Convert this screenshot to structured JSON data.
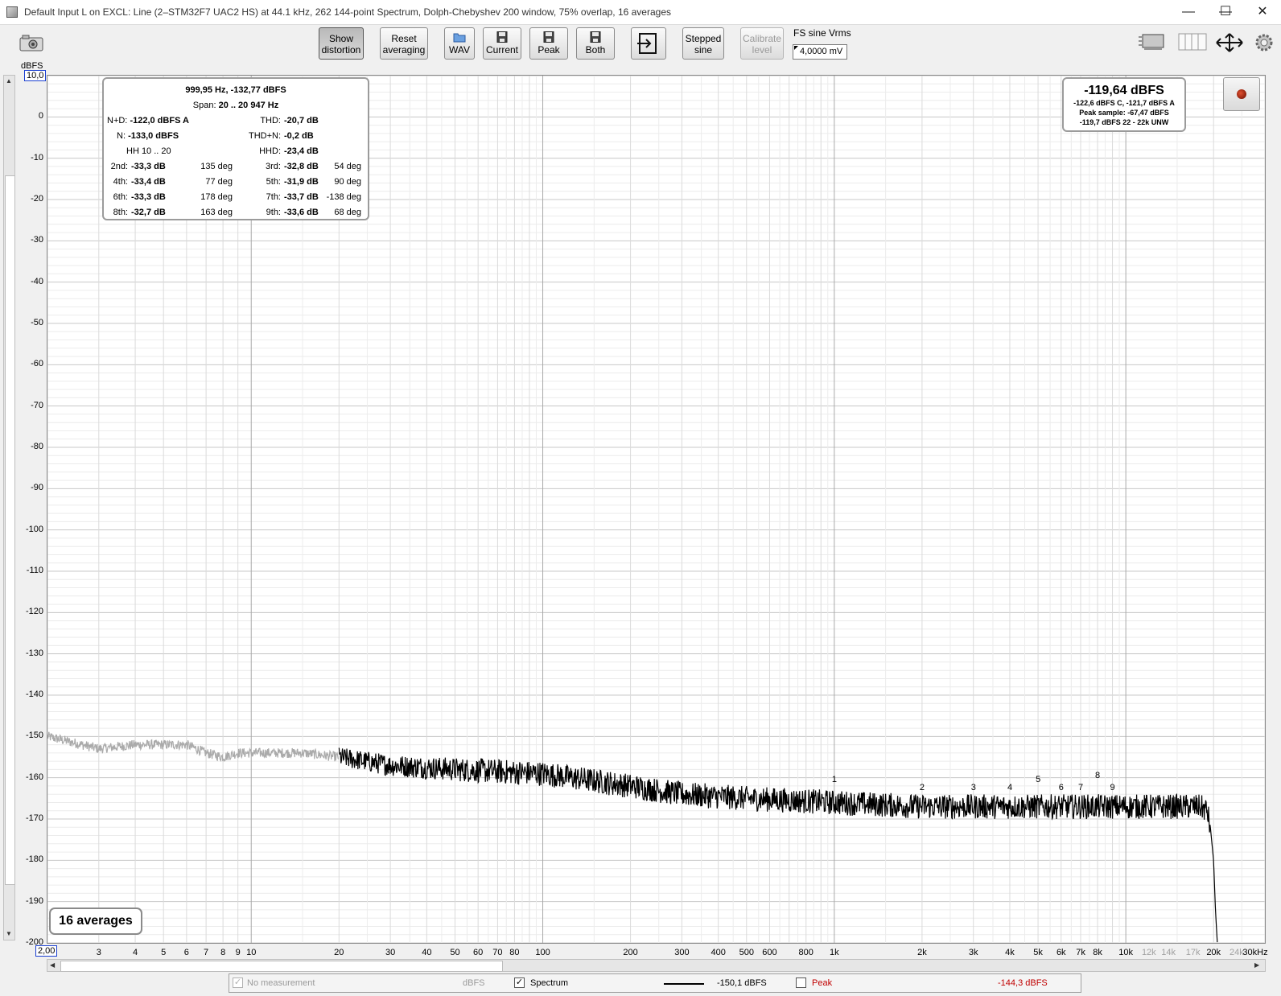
{
  "window": {
    "title": "Default Input L on EXCL: Line (2–STM32F7 UAC2 HS) at 44.1 kHz, 262 144-point Spectrum, Dolph-Chebyshev 200 window, 75% overlap, 16 averages",
    "minimize": "—",
    "maximize": "☐",
    "close": "✕"
  },
  "toolbar": {
    "show_distortion": [
      "Show",
      "distortion"
    ],
    "reset_averaging": [
      "Reset",
      "averaging"
    ],
    "wav": "WAV",
    "current": "Current",
    "peak": "Peak",
    "both": "Both",
    "stepped_sine": [
      "Stepped",
      "sine"
    ],
    "calibrate_level": [
      "Calibrate",
      "level"
    ],
    "fs_label": "FS sine Vrms",
    "fs_value": "4,0000 mV"
  },
  "axes": {
    "y_unit": "dBFS",
    "y_top_box": "10,0",
    "y_ticks": [
      "0",
      "-10",
      "-20",
      "-30",
      "-40",
      "-50",
      "-60",
      "-70",
      "-80",
      "-90",
      "-100",
      "-110",
      "-120",
      "-130",
      "-140",
      "-150",
      "-160",
      "-170",
      "-180",
      "-190",
      "-200"
    ],
    "x_left_box": "2,00",
    "x_ticks": [
      {
        "v": 3,
        "t": "3"
      },
      {
        "v": 4,
        "t": "4"
      },
      {
        "v": 5,
        "t": "5"
      },
      {
        "v": 6,
        "t": "6"
      },
      {
        "v": 7,
        "t": "7"
      },
      {
        "v": 8,
        "t": "8"
      },
      {
        "v": 9,
        "t": "9"
      },
      {
        "v": 10,
        "t": "10"
      },
      {
        "v": 20,
        "t": "20"
      },
      {
        "v": 30,
        "t": "30"
      },
      {
        "v": 40,
        "t": "40"
      },
      {
        "v": 50,
        "t": "50"
      },
      {
        "v": 60,
        "t": "60"
      },
      {
        "v": 70,
        "t": "70"
      },
      {
        "v": 80,
        "t": "80"
      },
      {
        "v": 100,
        "t": "100"
      },
      {
        "v": 200,
        "t": "200"
      },
      {
        "v": 300,
        "t": "300"
      },
      {
        "v": 400,
        "t": "400"
      },
      {
        "v": 500,
        "t": "500"
      },
      {
        "v": 600,
        "t": "600"
      },
      {
        "v": 800,
        "t": "800"
      },
      {
        "v": 1000,
        "t": "1k"
      },
      {
        "v": 2000,
        "t": "2k"
      },
      {
        "v": 3000,
        "t": "3k"
      },
      {
        "v": 4000,
        "t": "4k"
      },
      {
        "v": 5000,
        "t": "5k"
      },
      {
        "v": 6000,
        "t": "6k"
      },
      {
        "v": 7000,
        "t": "7k"
      },
      {
        "v": 8000,
        "t": "8k"
      },
      {
        "v": 10000,
        "t": "10k"
      },
      {
        "v": 12000,
        "t": "12k",
        "light": true
      },
      {
        "v": 14000,
        "t": "14k",
        "light": true
      },
      {
        "v": 17000,
        "t": "17k",
        "light": true
      },
      {
        "v": 20000,
        "t": "20k"
      },
      {
        "v": 24000,
        "t": "24k",
        "light": true
      },
      {
        "v": 30000,
        "t": "30kHz"
      }
    ]
  },
  "distortion": {
    "header": "999,95 Hz, -132,77 dBFS",
    "span_label": "Span:",
    "span_value": "20 .. 20 947 Hz",
    "nd_label": "N+D:",
    "nd_value": "-122,0 dBFS A",
    "thd_label": "THD:",
    "thd_value": "-20,7 dB",
    "n_label": "N:",
    "n_value": "-133,0 dBFS",
    "thdn_label": "THD+N:",
    "thdn_value": "-0,2 dB",
    "hh": "HH 10 .. 20",
    "hhd_label": "HHD:",
    "hhd_value": "-23,4 dB",
    "rows": [
      {
        "l1": "2nd:",
        "v1": "-33,3 dB",
        "p1": "135 deg",
        "l2": "3rd:",
        "v2": "-32,8 dB",
        "p2": "54 deg"
      },
      {
        "l1": "4th:",
        "v1": "-33,4 dB",
        "p1": "77 deg",
        "l2": "5th:",
        "v2": "-31,9 dB",
        "p2": "90 deg"
      },
      {
        "l1": "6th:",
        "v1": "-33,3 dB",
        "p1": "178 deg",
        "l2": "7th:",
        "v2": "-33,7 dB",
        "p2": "-138 deg"
      },
      {
        "l1": "8th:",
        "v1": "-32,7 dB",
        "p1": "163 deg",
        "l2": "9th:",
        "v2": "-33,6 dB",
        "p2": "68 deg"
      }
    ]
  },
  "level": {
    "main": "-119,64 dBFS",
    "line1": "-122,6 dBFS C, -121,7 dBFS A",
    "line2": "Peak sample: -67,47 dBFS",
    "line3": "-119,7 dBFS 22 - 22k UNW"
  },
  "averages_badge": "16 averages",
  "harmonic_markers": [
    {
      "label": "1",
      "f": 1000,
      "db": -162
    },
    {
      "label": "2",
      "f": 2000,
      "db": -164
    },
    {
      "label": "3",
      "f": 3000,
      "db": -164
    },
    {
      "label": "4",
      "f": 4000,
      "db": -164
    },
    {
      "label": "5",
      "f": 5000,
      "db": -162
    },
    {
      "label": "6",
      "f": 6000,
      "db": -164
    },
    {
      "label": "7",
      "f": 7000,
      "db": -164
    },
    {
      "label": "8",
      "f": 8000,
      "db": -161
    },
    {
      "label": "9",
      "f": 9000,
      "db": -164
    }
  ],
  "legend": {
    "no_measurement": "No measurement",
    "unit": "dBFS",
    "spectrum": "Spectrum",
    "spectrum_value": "-150,1 dBFS",
    "peak": "Peak",
    "peak_value": "-144,3 dBFS",
    "peak_color": "#c00000"
  },
  "chart_data": {
    "type": "line",
    "title": "",
    "xlabel": "",
    "ylabel": "dBFS",
    "x_scale": "log",
    "xlim": [
      2,
      30000
    ],
    "ylim": [
      -200,
      10
    ],
    "grid": true,
    "series": [
      {
        "name": "Spectrum",
        "color": "#000000",
        "light_below_hz": 20,
        "light_color": "#aaaaaa",
        "points": [
          [
            2,
            -150
          ],
          [
            3,
            -153
          ],
          [
            4,
            -152
          ],
          [
            5,
            -152
          ],
          [
            6,
            -152
          ],
          [
            7,
            -154
          ],
          [
            8,
            -155
          ],
          [
            9,
            -154
          ],
          [
            10,
            -154
          ],
          [
            15,
            -154
          ],
          [
            20,
            -155
          ],
          [
            30,
            -157
          ],
          [
            50,
            -158
          ],
          [
            100,
            -159
          ],
          [
            200,
            -162
          ],
          [
            300,
            -164
          ],
          [
            500,
            -165
          ],
          [
            1000,
            -166
          ],
          [
            2000,
            -167
          ],
          [
            5000,
            -167
          ],
          [
            10000,
            -167
          ],
          [
            15000,
            -167
          ],
          [
            18000,
            -167
          ],
          [
            19000,
            -168
          ],
          [
            19500,
            -172
          ],
          [
            20000,
            -180
          ],
          [
            20300,
            -192
          ],
          [
            20600,
            -200
          ]
        ],
        "noise_spread_db": 3
      }
    ]
  }
}
